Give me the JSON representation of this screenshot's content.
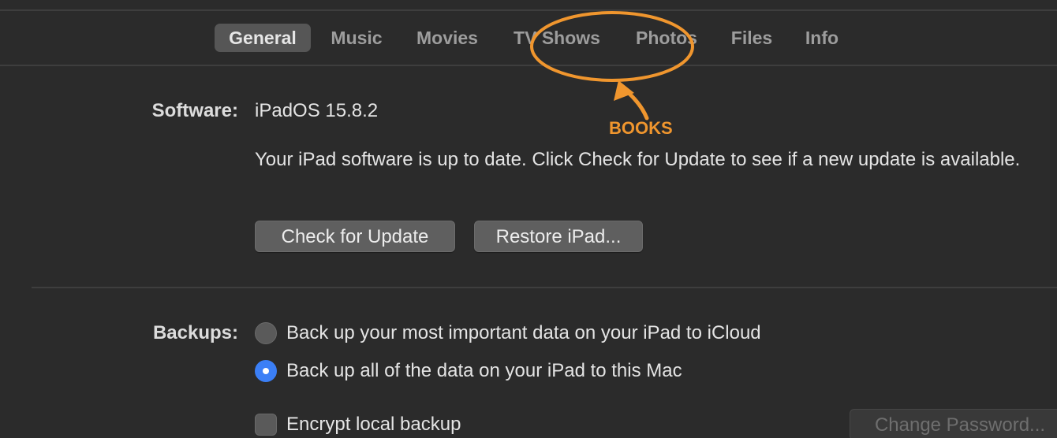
{
  "tabs": [
    {
      "label": "General",
      "selected": true
    },
    {
      "label": "Music"
    },
    {
      "label": "Movies"
    },
    {
      "label": "TV Shows"
    },
    {
      "label": "Photos"
    },
    {
      "label": "Files"
    },
    {
      "label": "Info"
    }
  ],
  "software": {
    "label": "Software:",
    "version": "iPadOS 15.8.2",
    "status": "Your iPad software is up to date. Click Check for Update to see if a new update is available.",
    "check_button": "Check for Update",
    "restore_button": "Restore iPad..."
  },
  "backups": {
    "label": "Backups:",
    "option_icloud": "Back up your most important data on your iPad to iCloud",
    "option_mac": "Back up all of the data on your iPad to this Mac",
    "selected_option": "option_mac",
    "encrypt_label": "Encrypt local backup",
    "encrypt_checked": false,
    "change_password_button": "Change Password..."
  },
  "annotation": {
    "text": "BOOKS",
    "color": "#f0962e"
  }
}
